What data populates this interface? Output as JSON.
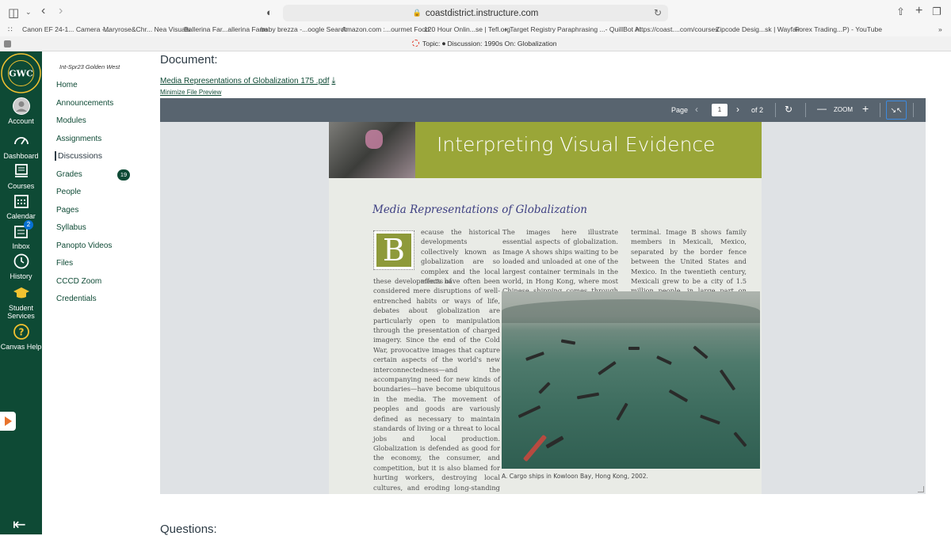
{
  "browser": {
    "url": "coastdistrict.instructure.com",
    "bookmarks": [
      "Canon EF 24-1... Camera -...",
      "Maryrose&Chr... Nea Visuals",
      "Ballerina Far...allerina Farm",
      "baby brezza -...oogle Search",
      "Amazon.com :...ourmet Food",
      "120 Hour Onlin...se | Tefl.org",
      "+ Target Registry",
      "Paraphrasing ...- QuillBot AI",
      "https://coast....com/courses",
      "Zipcode Desig...sk | Wayfair",
      "Forex Trading...P) - YouTube"
    ],
    "tab_title": "Topic: ⏺ Discussion: 1990s On: Globalization"
  },
  "global_nav": {
    "items": [
      {
        "label": "Account"
      },
      {
        "label": "Dashboard"
      },
      {
        "label": "Courses"
      },
      {
        "label": "Calendar"
      },
      {
        "label": "Inbox",
        "badge": "2"
      },
      {
        "label": "History"
      },
      {
        "label": "Student Services"
      },
      {
        "label": "Canvas Help"
      }
    ]
  },
  "course_nav": {
    "course_name": "Int-Spr23 Golden West",
    "items": [
      "Home",
      "Announcements",
      "Modules",
      "Assignments",
      "Discussions",
      "Grades",
      "People",
      "Pages",
      "Syllabus",
      "Panopto Videos",
      "Files",
      "CCCD Zoom",
      "Credentials"
    ],
    "grades_count": "19"
  },
  "main": {
    "heading": "Document:",
    "file_link": "Media Representations of Globalization 175 .pdf",
    "minimize": "Minimize File Preview",
    "questions_heading": "Questions:"
  },
  "viewer": {
    "page_label": "Page",
    "page_current": "1",
    "page_total": "of 2",
    "zoom_label": "ZOOM"
  },
  "pdf": {
    "banner_title": "Interpreting Visual Evidence",
    "article_title": "Media Representations of Globalization",
    "dropcap": "B",
    "col1_top": "ecause the historical developments collectively known as globalization are so complex and the local effects of",
    "col1_rest": "these developments have often been considered mere disruptions of well-entrenched habits or ways of life, debates about globalization are particularly open to manipulation through the presentation of charged imagery. Since the end of the Cold War, provocative images that capture certain aspects of the world's new interconnectedness—and the accompanying need for new kinds of boundaries—have become ubiquitous in the media. The movement of peoples and goods are variously defined as necessary to maintain standards of living or a threat to local jobs and local production. Globalization is defended as good for the economy, the consumer, and competition, but it is also blamed for hurting workers, destroying local cultures, and eroding long-standing definitions of national identity.",
    "col2": "The images here illustrate essential aspects of globalization. Image A shows ships waiting to be loaded and unloaded at one of the largest container terminals in the world, in Hong Kong, where most Chinese shipping comes through this",
    "col3": "terminal. Image B shows family members in Mexicali, Mexico, separated by the border fence between the United States and Mexico. In the twentieth century, Mexicali grew to be a city of 1.5 million people, in large part on the prosperity",
    "caption": "A. Cargo ships in Kowloon Bay, Hong Kong, 2002."
  }
}
